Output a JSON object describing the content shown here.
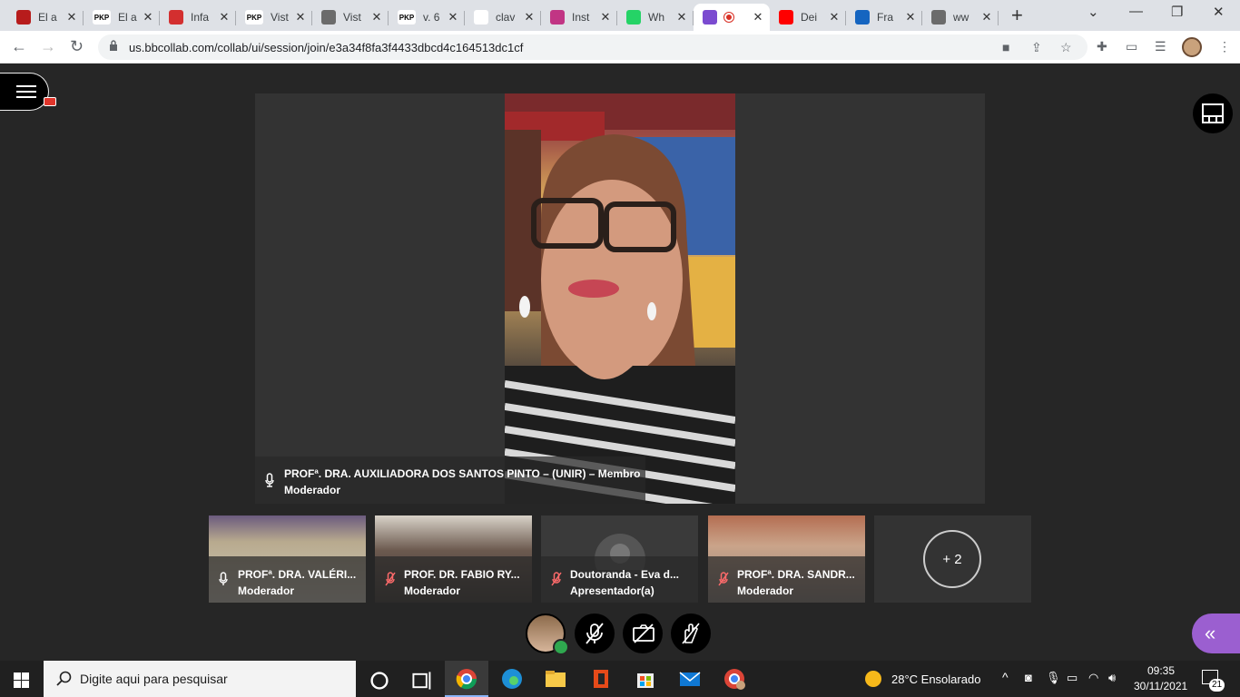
{
  "browser": {
    "tabs": [
      {
        "title": "El a",
        "icon": "red-circle-icon",
        "color": "#b71c1c"
      },
      {
        "title": "El a",
        "icon": "pkp-icon",
        "color": "#ffffff"
      },
      {
        "title": "Infa",
        "icon": "infa-icon",
        "color": "#d32f2f"
      },
      {
        "title": "Vist",
        "icon": "pkp-icon",
        "color": "#ffffff"
      },
      {
        "title": "Vist",
        "icon": "globe-icon",
        "color": "#6b6b6b"
      },
      {
        "title": "v. 6",
        "icon": "pkp-icon",
        "color": "#ffffff"
      },
      {
        "title": "clav",
        "icon": "google-icon",
        "color": "#ffffff"
      },
      {
        "title": "Inst",
        "icon": "instagram-icon",
        "color": "#c13584"
      },
      {
        "title": "Wh",
        "icon": "whatsapp-icon",
        "color": "#25d366"
      },
      {
        "title": "",
        "icon": "collab-icon",
        "color": "#7b4bd0"
      },
      {
        "title": "Dei",
        "icon": "youtube-icon",
        "color": "#ff0000"
      },
      {
        "title": "Fra",
        "icon": "bookmark-icon",
        "color": "#1565c0"
      },
      {
        "title": "ww",
        "icon": "globe-icon",
        "color": "#6b6b6b"
      }
    ],
    "url": "us.bbcollab.com/collab/ui/session/join/e3a34f8fa3f4433dbcd4c164513dc1cf"
  },
  "main_video": {
    "name_line1": "PROFª. DRA. AUXILIADORA DOS SANTOS PINTO – (UNIR) – Membro",
    "name_line2": "Moderador"
  },
  "participants": [
    {
      "name": "PROFª. DRA. VALÉRI...",
      "role": "Moderador",
      "mic": "on"
    },
    {
      "name": "PROF. DR. FABIO RY...",
      "role": "Moderador",
      "mic": "muted"
    },
    {
      "name": "Doutoranda - Eva d...",
      "role": "Apresentador(a)",
      "mic": "muted"
    },
    {
      "name": "PROFª. DRA. SANDR...",
      "role": "Moderador",
      "mic": "muted"
    }
  ],
  "more_count": "+ 2",
  "taskbar": {
    "search_placeholder": "Digite aqui para pesquisar",
    "weather": "28°C  Ensolarado",
    "time": "09:35",
    "date": "30/11/2021",
    "notifications": "21"
  }
}
